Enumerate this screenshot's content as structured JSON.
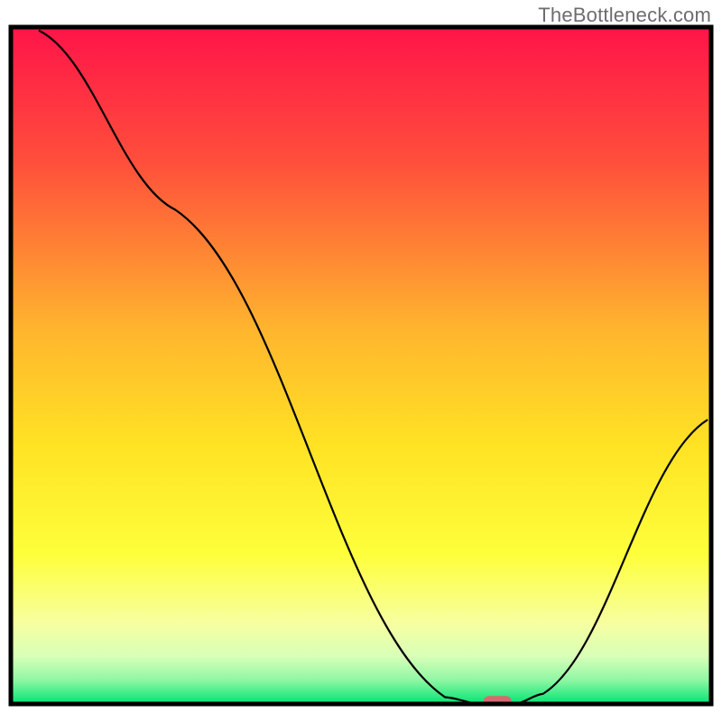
{
  "watermark": "TheBottleneck.com",
  "chart_data": {
    "type": "line",
    "title": "",
    "xlabel": "",
    "ylabel": "",
    "xlim": [
      0,
      100
    ],
    "ylim": [
      0,
      100
    ],
    "gradient_stops": [
      {
        "offset": 0.0,
        "color": "#ff1449"
      },
      {
        "offset": 0.2,
        "color": "#ff4f3b"
      },
      {
        "offset": 0.45,
        "color": "#ffb62e"
      },
      {
        "offset": 0.62,
        "color": "#ffe324"
      },
      {
        "offset": 0.78,
        "color": "#feff3b"
      },
      {
        "offset": 0.88,
        "color": "#f7ffa0"
      },
      {
        "offset": 0.93,
        "color": "#d8ffb8"
      },
      {
        "offset": 0.965,
        "color": "#8ef7a4"
      },
      {
        "offset": 1.0,
        "color": "#00e472"
      }
    ],
    "series": [
      {
        "name": "bottleneck-curve",
        "points": [
          {
            "x": 4.0,
            "y": 99.5
          },
          {
            "x": 23.5,
            "y": 73.0
          },
          {
            "x": 62.0,
            "y": 1.0
          },
          {
            "x": 67.0,
            "y": 0.0
          },
          {
            "x": 72.0,
            "y": 0.0
          },
          {
            "x": 76.0,
            "y": 1.5
          },
          {
            "x": 99.5,
            "y": 42.0
          }
        ]
      }
    ],
    "marker": {
      "name": "optimal-point",
      "x": 69.5,
      "y": 0.3,
      "width": 4.0,
      "color": "#d56a6f"
    },
    "frame": {
      "inset_top": 30,
      "inset_left": 12,
      "inset_right": 12,
      "inset_bottom": 20,
      "stroke_width": 5,
      "stroke_color": "#000000"
    },
    "curve_stroke": {
      "width": 2.2,
      "color": "#000000"
    }
  }
}
